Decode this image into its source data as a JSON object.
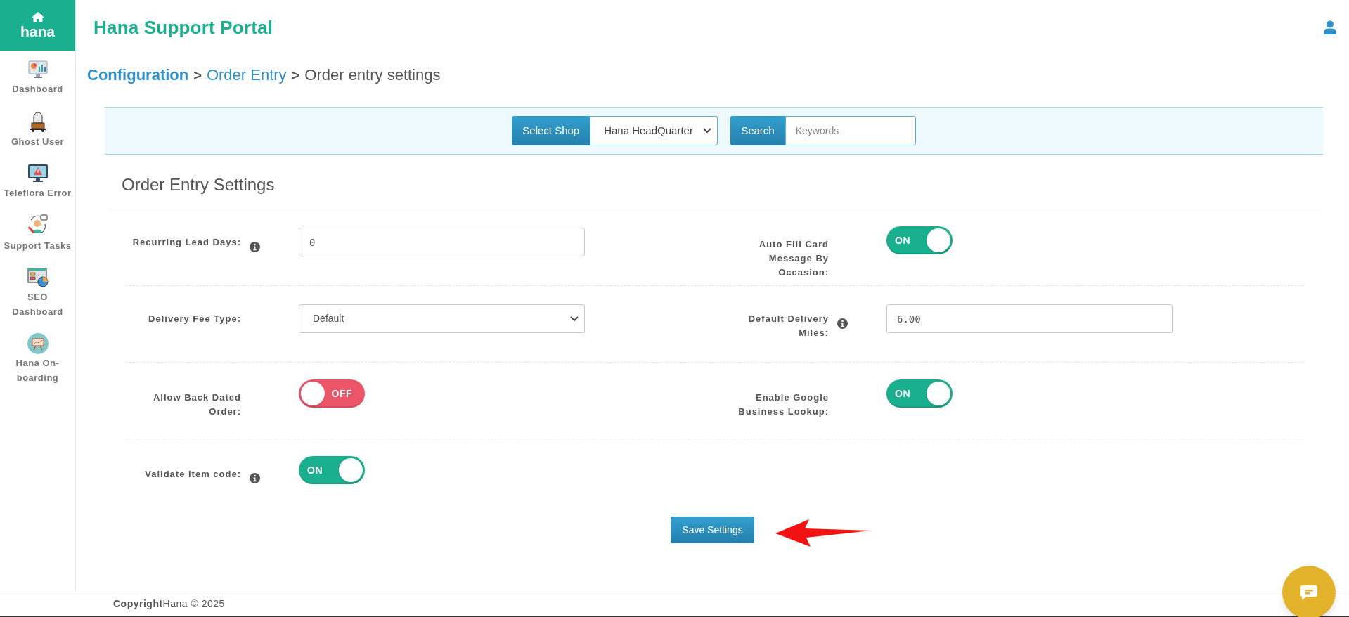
{
  "logo": {
    "label": "hana"
  },
  "sidebar": {
    "items": [
      {
        "label": "Dashboard"
      },
      {
        "label": "Ghost User"
      },
      {
        "label": "Teleflora Error"
      },
      {
        "label": "Support Tasks"
      },
      {
        "label": "SEO Dashboard"
      },
      {
        "label": "Hana On-boarding"
      }
    ]
  },
  "header": {
    "title": "Hana Support Portal"
  },
  "breadcrumb": [
    {
      "label": "Configuration",
      "kind": "root"
    },
    {
      "label": ">",
      "kind": "separator"
    },
    {
      "label": "Order Entry",
      "kind": "link"
    },
    {
      "label": ">",
      "kind": "separator"
    },
    {
      "label": "Order entry settings",
      "kind": "current"
    }
  ],
  "filter_bar": {
    "shop_label": "Select Shop",
    "shop_value": "Hana HeadQuarter",
    "search_label": "Search",
    "search_placeholder": "Keywords"
  },
  "section_title": "Order Entry Settings",
  "settings_rows": [
    [
      {
        "label": "Recurring Lead Days:",
        "info": true,
        "kind": "input",
        "value": "0"
      },
      {
        "label": "Auto Fill Card Message By Occasion:",
        "info": false,
        "kind": "toggle",
        "on": true,
        "toggle_text": "ON"
      }
    ],
    [
      {
        "label": "Delivery Fee Type:",
        "info": false,
        "kind": "select",
        "value": "Default"
      },
      {
        "label": "Default Delivery Miles:",
        "info": true,
        "kind": "input",
        "value": "6.00"
      }
    ],
    [
      {
        "label": "Allow Back Dated Order:",
        "info": false,
        "kind": "toggle",
        "on": false,
        "toggle_text": "OFF"
      },
      {
        "label": "Enable Google Business Lookup:",
        "info": false,
        "kind": "toggle",
        "on": true,
        "toggle_text": "ON"
      }
    ],
    [
      {
        "label": "Validate Item code:",
        "info": true,
        "kind": "toggle",
        "on": true,
        "toggle_text": "ON"
      }
    ]
  ],
  "save_button": "Save Settings",
  "footer": "**Copyright**Hana © 2025"
}
